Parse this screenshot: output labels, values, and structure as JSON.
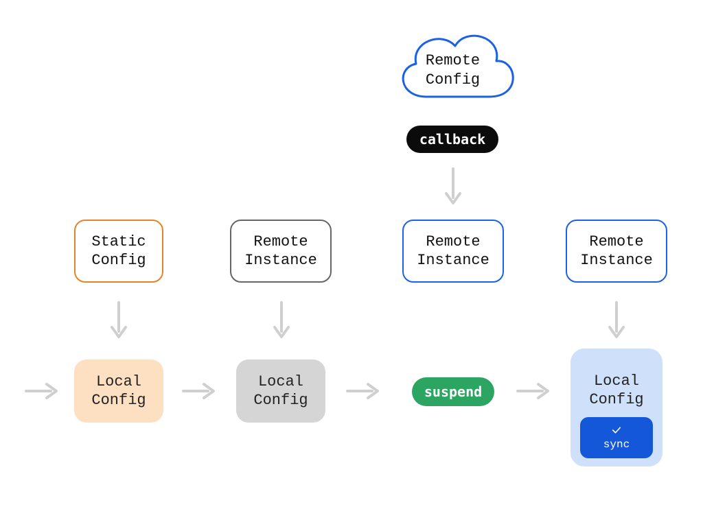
{
  "cloud": {
    "label": "Remote\nConfig"
  },
  "pills": {
    "callback": "callback",
    "suspend": "suspend"
  },
  "row_top": {
    "static_config": "Static\nConfig",
    "remote_instance_1": "Remote\nInstance",
    "remote_instance_2": "Remote\nInstance",
    "remote_instance_3": "Remote\nInstance"
  },
  "row_bottom": {
    "local_config_1": "Local\nConfig",
    "local_config_2": "Local\nConfig",
    "local_config_3": "Local\nConfig"
  },
  "sync_badge": {
    "label": "sync"
  }
}
